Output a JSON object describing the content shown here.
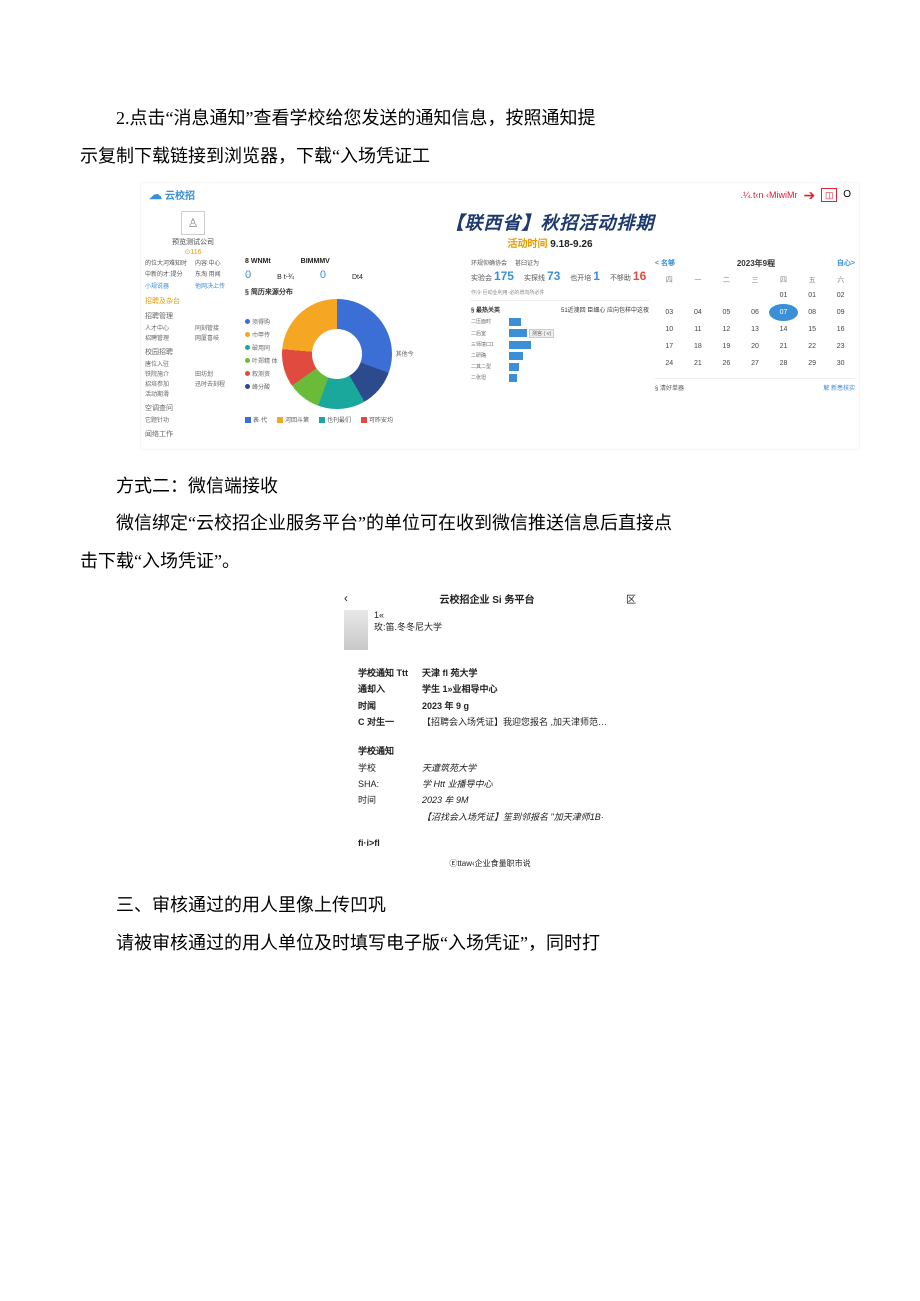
{
  "para1a": "2.点击“消息通知”查看学校给您发送的通知信息，按照通知提",
  "para1b": "示复制下载链接到浏览器，下载“入场凭证工",
  "method2": "方式二：微信端接收",
  "para2a": "微信绑定“云校招企业服务平台”的单位可在收到微信推送信息后直接点",
  "para2b": "击下载“入场凭证”。",
  "section3": "三、审核通过的用人里像上传凹巩",
  "para3": "请被审核通过的用人单位及时填写电子版“入场凭证”，同时打",
  "dashboard": {
    "logo": "云校招",
    "top_right_text": ".¼.t‹n ‹MiwiMr",
    "top_right_num": "O",
    "sidebar": {
      "company": "预览测试公司",
      "badge": "⊙116",
      "row1a": "的位大河难知时",
      "row1b": "内容:中心",
      "row2a": "中新的才:提分",
      "row2b": "东淘 用闻",
      "link1": "小规说器",
      "link2": "他网决上传",
      "g1_title": "招聘及杂台",
      "g2_title": "招聘管理",
      "g2a": "人才中心",
      "g2b": "同刻管接",
      "g2c": "招聘管理",
      "g2d": "网厦喜岐",
      "g3_title": "校园招聘",
      "g3a": "唐位入驻",
      "g3b": "铁院施介",
      "g3c": "田坊划",
      "g3d": "招培参加",
      "g3e": "迅时去刻程",
      "g3f": "活动期滑",
      "g4_title": "空调查问",
      "g4a": "它题针功",
      "g5_title": "闻络工作"
    },
    "banner": "【联西省】秋招活动排期",
    "banner_sub_label": "活动时间",
    "banner_sub_val": "9.18-9.26",
    "col1": {
      "h1": "8 WNMt",
      "h2": "BIMMMV",
      "v1": "0",
      "l1": "B t-¾",
      "v2": "0",
      "l2": "Dt4",
      "section": "§ 简历来源分布",
      "legend": [
        "须得购",
        "巾甲传",
        "破用同",
        "叶郑精 体",
        "叙测资",
        "峰分酸"
      ],
      "right_label": "其他今",
      "footer": [
        "表·代",
        "河回斗第",
        "也刊最们",
        "可昨安均"
      ]
    },
    "col2": {
      "top1": "环规仰确协会",
      "top2": "甚臼证为",
      "topnote": "作冷·巨动业利用·必的增向所必件",
      "m1_l": "实验会",
      "m1_v": "175",
      "m2_l": "实探线",
      "m2_v": "73",
      "m3_l": "也开培",
      "m3_v": "1",
      "m4_l": "不够助",
      "m4_v": "16",
      "h_title_l": "§ 最热关英",
      "h_title_r": "51近澳回 臣细心 应向包样中这夜",
      "bars": [
        {
          "name": "二压面时",
          "w": 12
        },
        {
          "name": "二后室",
          "w": 18
        },
        {
          "name": "三师境口1",
          "w": 22
        },
        {
          "name": "二研确",
          "w": 14
        },
        {
          "name": "二其二型",
          "w": 10
        },
        {
          "name": "二张坦",
          "w": 8
        }
      ],
      "tag": "测宫·(·v)"
    },
    "cal": {
      "prev": "< 名够",
      "title": "2023年9程",
      "next": "自心>",
      "dow": [
        "四",
        "一",
        "二",
        "三",
        "四",
        "五",
        "六"
      ],
      "rows": [
        [
          "",
          "",
          "",
          "",
          "01",
          "01",
          "02"
        ],
        [
          "03",
          "04",
          "05",
          "06",
          "07",
          "08",
          "09"
        ],
        [
          "10",
          "11",
          "12",
          "13",
          "14",
          "15",
          "16"
        ],
        [
          "17",
          "18",
          "19",
          "20",
          "21",
          "22",
          "23"
        ],
        [
          "24",
          "21",
          "26",
          "27",
          "28",
          "29",
          "30"
        ]
      ],
      "today": "07",
      "foot_l": "§ 清好单器",
      "foot_r": "解 新患核实"
    }
  },
  "wechat": {
    "title": "云校招企业 Si 务平台",
    "close": "区",
    "user_line1": "1«",
    "user_line2": "玫:笛.冬冬尼大学",
    "block1": {
      "r1k": "学校通知 Ttt",
      "r1v": "天津 fl 苑大学",
      "r2k": "通却入",
      "r2v": "学生 1»业相导中心",
      "r3k": "时闻",
      "r3v": "2023 年 9           g",
      "r4k": "C 对生一",
      "r4v": "【招聘会入场凭证】我迎您报名 ,加天津师范…"
    },
    "block2_title": "学校通知",
    "block2": {
      "r1k": "学校",
      "r1v": "天遭筑苑大学",
      "r2k": "SHA:",
      "r2v": "学 Htt 业播导中心",
      "r3k": "时间",
      "r3v": "2023 牟 9M",
      "r4v": "【沼找会入场凭证】笙到邻报名 \"加天津师1B·"
    },
    "sep": "fi·i>fl",
    "footer": "Ⓔttaw‹企业食量职市说"
  }
}
